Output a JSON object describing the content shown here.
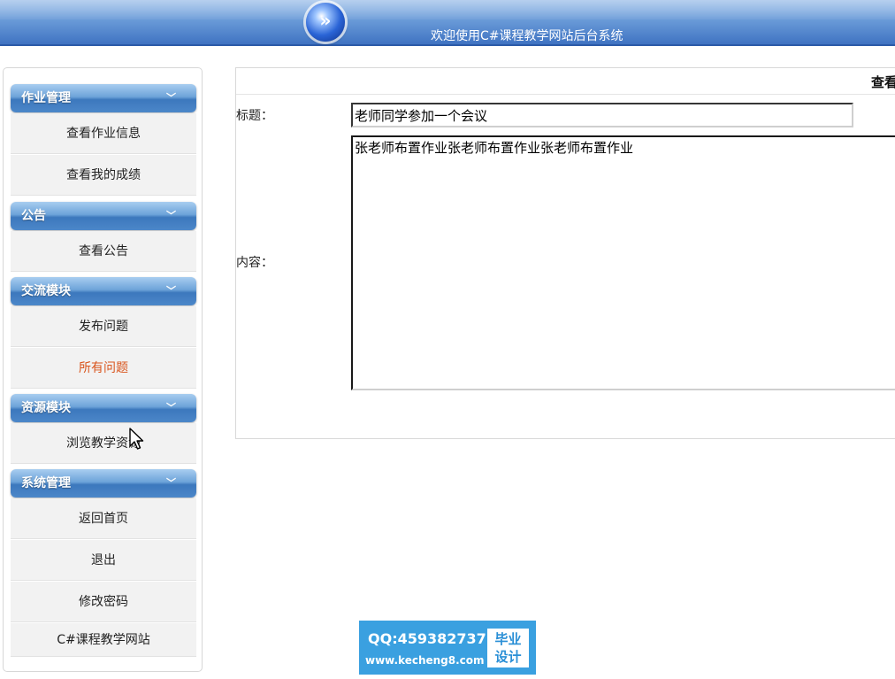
{
  "header": {
    "site_title": "欢迎使用C#课程教学网站后台系统",
    "logo_glyph": "»",
    "bar_color": "#4f86cf"
  },
  "sidebar": {
    "groups": [
      {
        "title": "作业管理",
        "items": [
          {
            "label": "查看作业信息"
          },
          {
            "label": "查看我的成绩"
          }
        ]
      },
      {
        "title": "公告",
        "items": [
          {
            "label": "查看公告"
          }
        ]
      },
      {
        "title": "交流模块",
        "items": [
          {
            "label": "发布问题"
          },
          {
            "label": "所有问题",
            "active": true
          }
        ]
      },
      {
        "title": "资源模块",
        "items": [
          {
            "label": "浏览教学资源"
          }
        ]
      },
      {
        "title": "系统管理",
        "items": [
          {
            "label": "返回首页"
          },
          {
            "label": "退出"
          },
          {
            "label": "修改密码"
          },
          {
            "label": "C#课程教学网站"
          }
        ]
      }
    ],
    "chevron_glyph": "»",
    "active_color": "#d9551d"
  },
  "main": {
    "panel_title": "查看",
    "title_label": "标题：",
    "title_value": "老师同学参加一个会议",
    "content_label": "内容：",
    "content_value": "张老师布置作业张老师布置作业张老师布置作业"
  },
  "watermark": {
    "qq": "QQ:459382737",
    "url": "www.kecheng8.com",
    "badge_line1": "毕业",
    "badge_line2": "设计"
  }
}
